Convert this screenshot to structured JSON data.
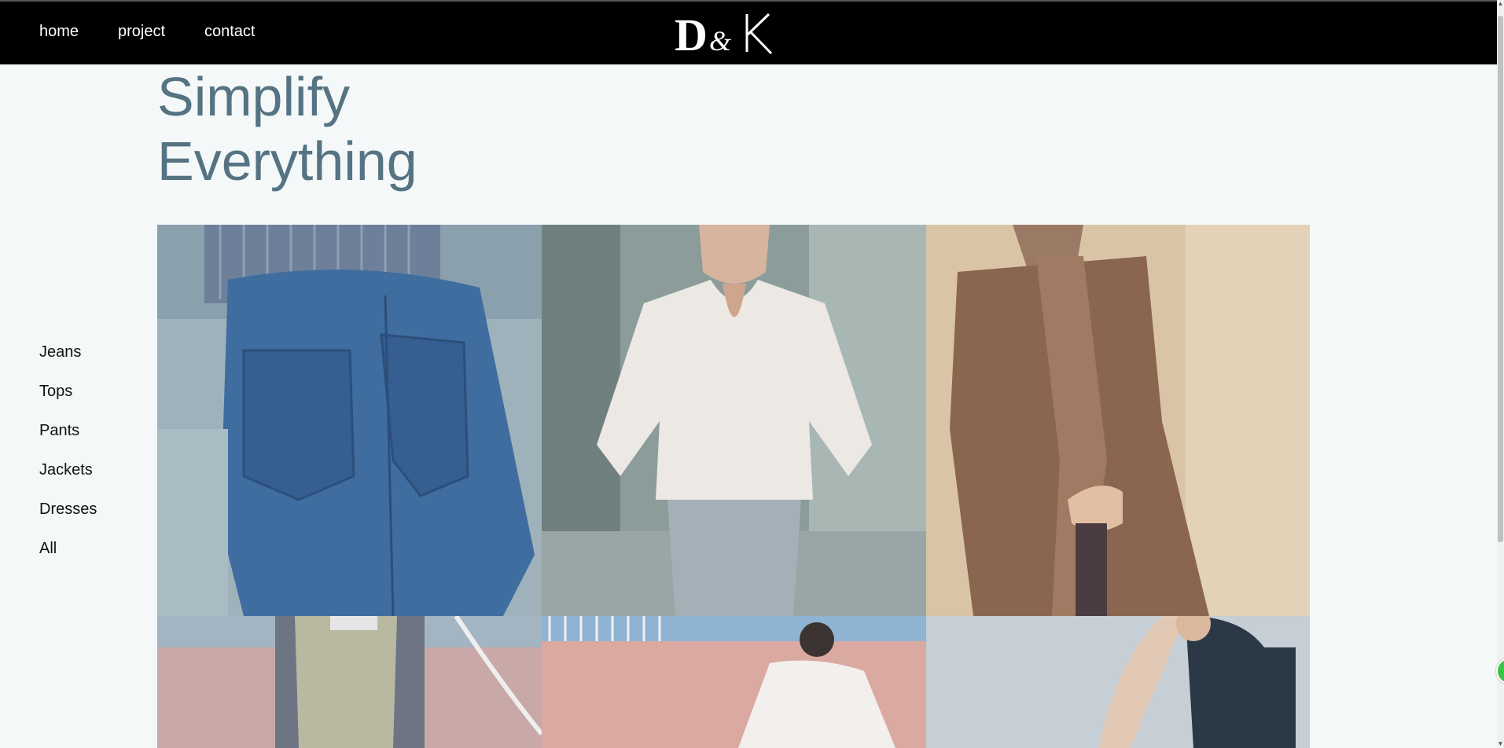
{
  "nav": {
    "items": [
      "home",
      "project",
      "contact"
    ]
  },
  "logo": {
    "text": "D&K"
  },
  "hero": {
    "line1": "Simplify",
    "line2": "Everything"
  },
  "sidebar": {
    "items": [
      "Jeans",
      "Tops",
      "Pants",
      "Jackets",
      "Dresses",
      "All"
    ]
  },
  "colors": {
    "topbar": "#000000",
    "page_bg": "#f4f8f9",
    "title": "#557382"
  }
}
